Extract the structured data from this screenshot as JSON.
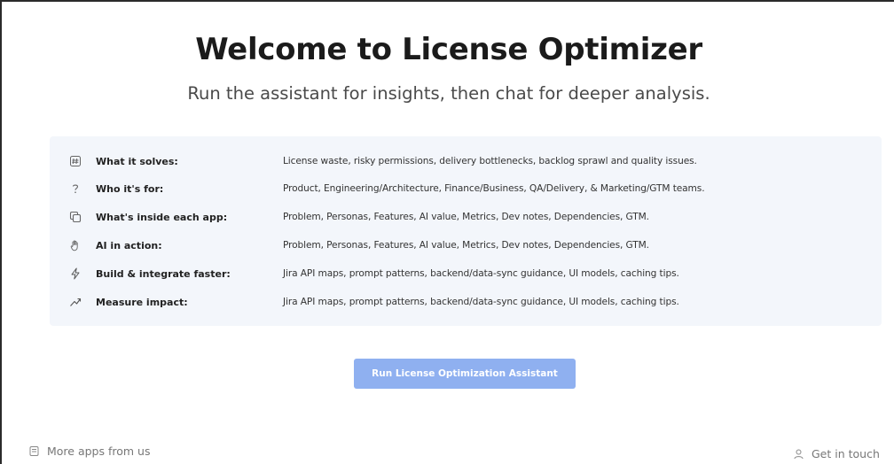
{
  "header": {
    "title": "Welcome to License Optimizer",
    "subtitle": "Run the assistant for insights, then chat for deeper analysis."
  },
  "features": {
    "rows": [
      {
        "icon": "hash-icon",
        "label": "What it solves:",
        "value": "License waste, risky permissions, delivery bottlenecks, backlog sprawl and quality issues."
      },
      {
        "icon": "question-icon",
        "label": "Who it's for:",
        "value": "Product, Engineering/Architecture, Finance/Business, QA/Delivery, & Marketing/GTM teams."
      },
      {
        "icon": "copy-icon",
        "label": "What's inside each app:",
        "value": "Problem, Personas, Features, AI value, Metrics, Dev notes, Dependencies, GTM."
      },
      {
        "icon": "hand-icon",
        "label": "AI in action:",
        "value": "Problem, Personas, Features, AI value, Metrics, Dev notes, Dependencies, GTM."
      },
      {
        "icon": "lightning-icon",
        "label": "Build & integrate faster:",
        "value": "Jira API maps, prompt patterns, backend/data-sync guidance, UI models, caching tips."
      },
      {
        "icon": "trend-icon",
        "label": "Measure impact:",
        "value": "Jira API maps, prompt patterns, backend/data-sync guidance, UI models, caching tips."
      }
    ]
  },
  "cta": {
    "label": "Run License Optimization Assistant"
  },
  "footer": {
    "left_label": "More apps from us",
    "right_label": "Get in touch"
  },
  "colors": {
    "panel_bg": "#f3f6fb",
    "cta_bg": "#8fb0f0",
    "title": "#1b1b1b"
  }
}
